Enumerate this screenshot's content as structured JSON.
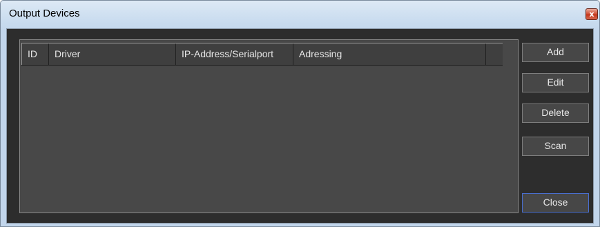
{
  "window": {
    "title": "Output Devices",
    "close_glyph": "x"
  },
  "list": {
    "columns": [
      "ID",
      "Driver",
      "IP-Address/Serialport",
      "Adressing"
    ],
    "rows": []
  },
  "buttons": {
    "add": "Add",
    "edit": "Edit",
    "delete": "Delete",
    "scan": "Scan",
    "close": "Close"
  },
  "colors": {
    "client_bg": "#2d2d2d",
    "list_bg": "#484848",
    "button_bg": "#474747",
    "focus_border": "#4a6fd0",
    "titlebar": "#c9dcef",
    "close_button": "#c3361b"
  },
  "icons": {
    "close": "close-icon"
  }
}
